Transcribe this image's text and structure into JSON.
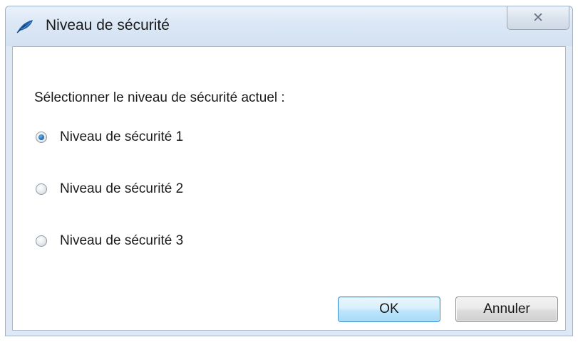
{
  "window": {
    "title": "Niveau de sécurité",
    "close_glyph": "✕",
    "app_icon": "feather-icon"
  },
  "dialog": {
    "prompt": "Sélectionner le niveau de sécurité actuel :",
    "options": [
      {
        "label": "Niveau de sécurité 1",
        "selected": true
      },
      {
        "label": "Niveau de sécurité 2",
        "selected": false
      },
      {
        "label": "Niveau de sécurité 3",
        "selected": false
      }
    ]
  },
  "buttons": {
    "ok_label": "OK",
    "cancel_label": "Annuler"
  },
  "colors": {
    "accent": "#1f6fb8",
    "titlebar": "#dbe7f5"
  }
}
